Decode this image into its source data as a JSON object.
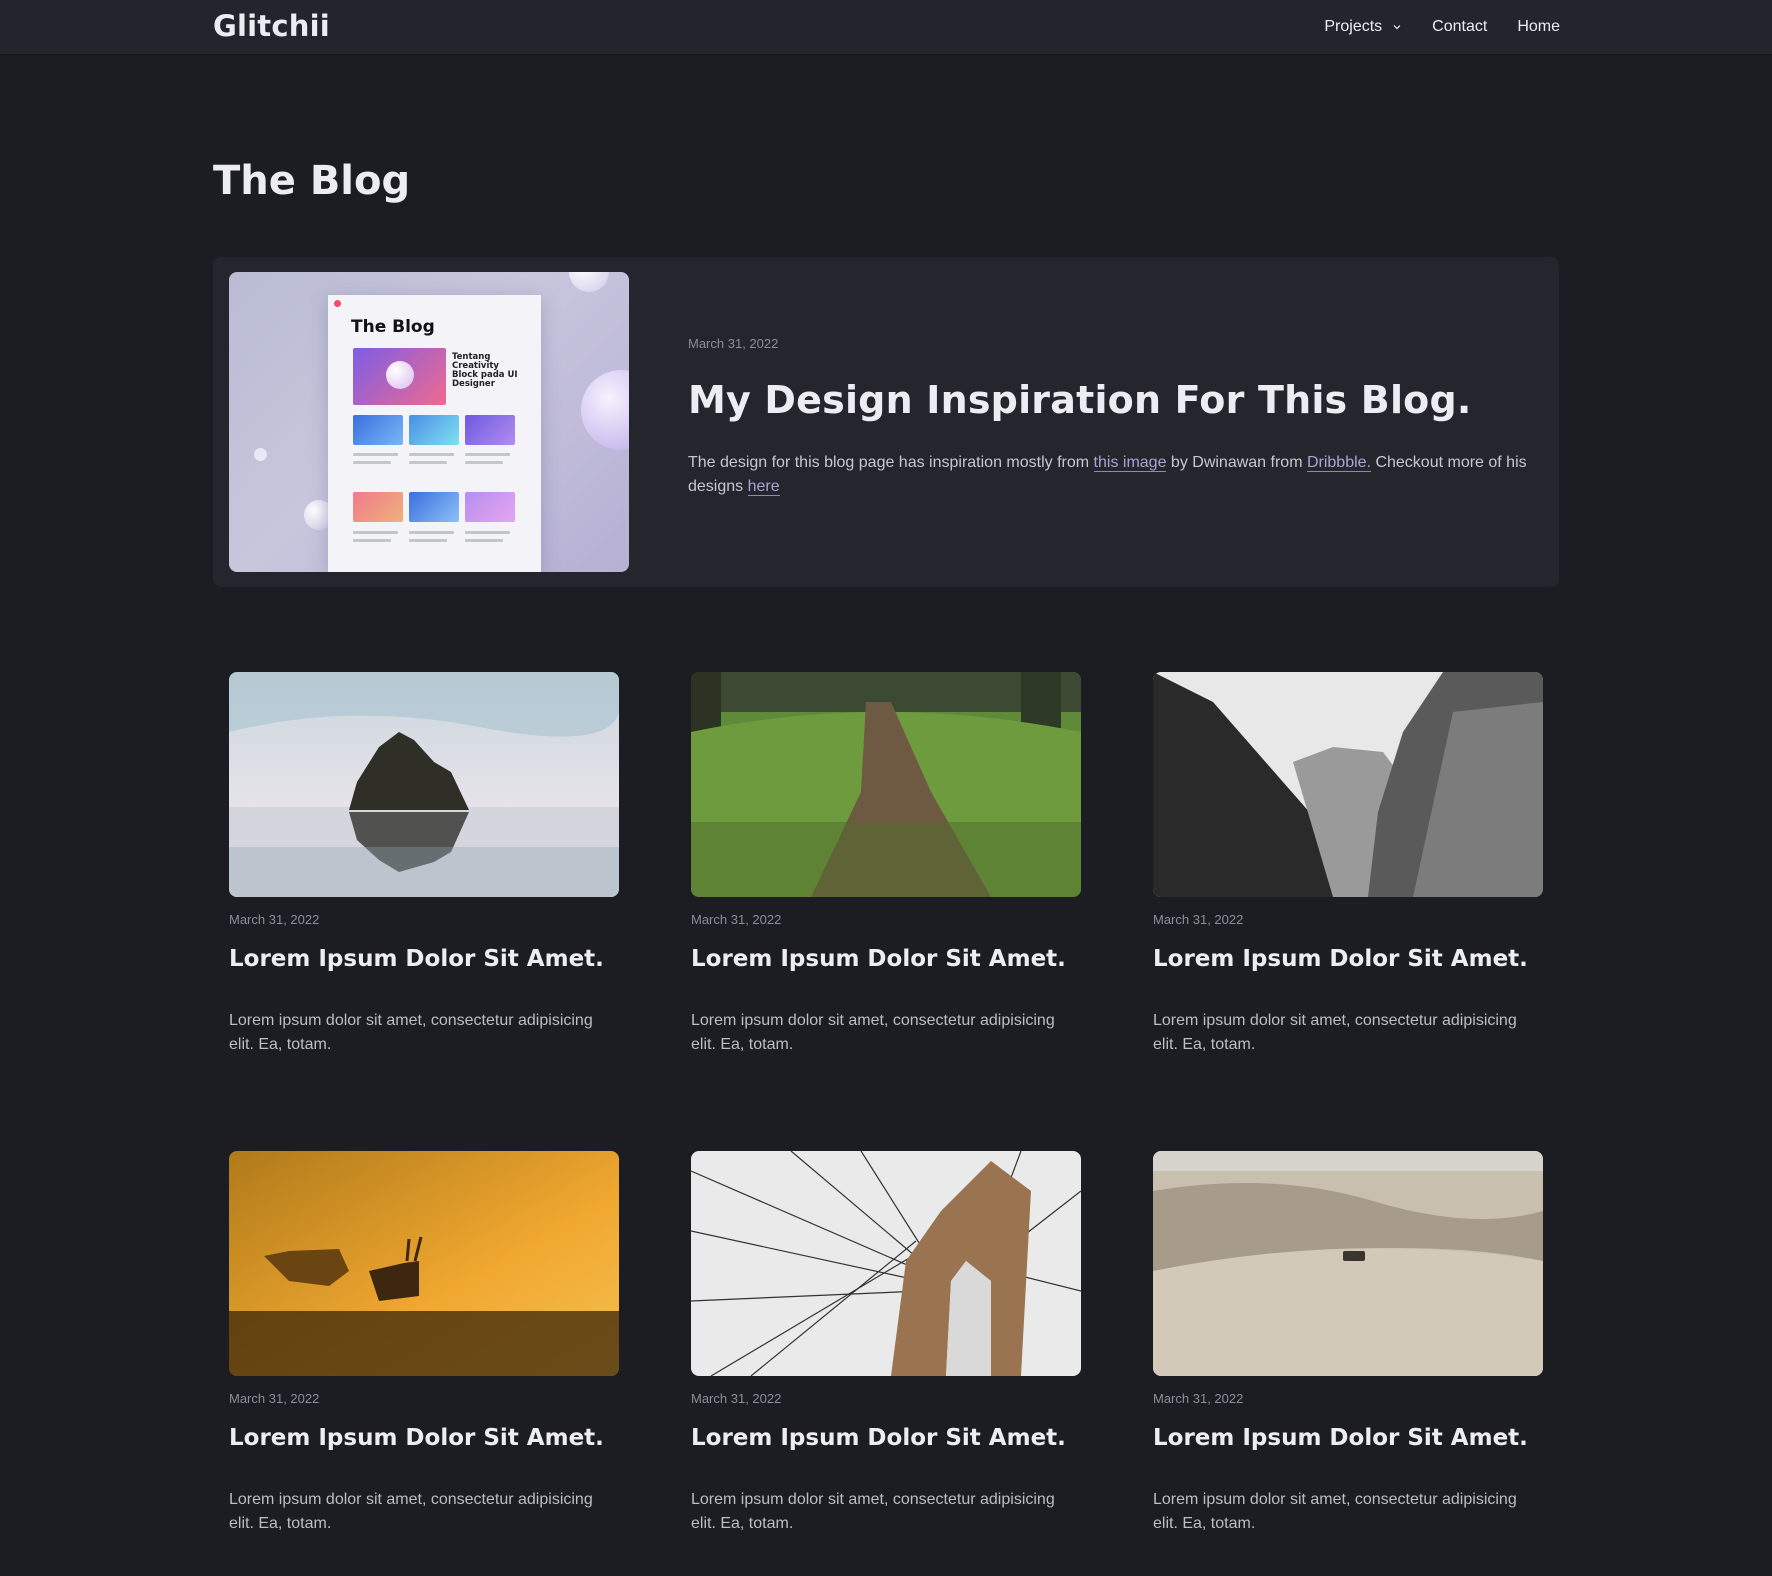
{
  "nav": {
    "brand": "Glitchii",
    "links": [
      "Projects",
      "Contact",
      "Home"
    ]
  },
  "page": {
    "title": "The Blog"
  },
  "featured": {
    "date": "March 31, 2022",
    "title": "My Design Inspiration For This Blog.",
    "desc_pre": "The design for this blog page has inspiration mostly from ",
    "link1": "this image",
    "desc_mid": " by Dwinawan from ",
    "link2": "Dribbble.",
    "desc_post": " Checkout more of his designs ",
    "link3": "here",
    "thumb": {
      "title": "The Blog",
      "hero_text": "Tentang Creativity Block pada UI Designer"
    }
  },
  "posts": [
    {
      "date": "March 31, 2022",
      "title": "Lorem Ipsum Dolor Sit Amet.",
      "desc": "Lorem ipsum dolor sit amet, consectetur adipisicing elit. Ea, totam.",
      "image": "sea-rock-photo"
    },
    {
      "date": "March 31, 2022",
      "title": "Lorem Ipsum Dolor Sit Amet.",
      "desc": "Lorem ipsum dolor sit amet, consectetur adipisicing elit. Ea, totam.",
      "image": "forest-path-photo"
    },
    {
      "date": "March 31, 2022",
      "title": "Lorem Ipsum Dolor Sit Amet.",
      "desc": "Lorem ipsum dolor sit amet, consectetur adipisicing elit. Ea, totam.",
      "image": "misty-valley-photo"
    },
    {
      "date": "March 31, 2022",
      "title": "Lorem Ipsum Dolor Sit Amet.",
      "desc": "Lorem ipsum dolor sit amet, consectetur adipisicing elit. Ea, totam.",
      "image": "deer-sunrise-photo"
    },
    {
      "date": "March 31, 2022",
      "title": "Lorem Ipsum Dolor Sit Amet.",
      "desc": "Lorem ipsum dolor sit amet, consectetur adipisicing elit. Ea, totam.",
      "image": "bridge-cables-photo"
    },
    {
      "date": "March 31, 2022",
      "title": "Lorem Ipsum Dolor Sit Amet.",
      "desc": "Lorem ipsum dolor sit amet, consectetur adipisicing elit. Ea, totam.",
      "image": "desert-dunes-photo"
    }
  ],
  "colors": {
    "background": "#1c1c23",
    "navbar": "#24242c",
    "card": "#25252d",
    "link": "#a6a6d8"
  }
}
